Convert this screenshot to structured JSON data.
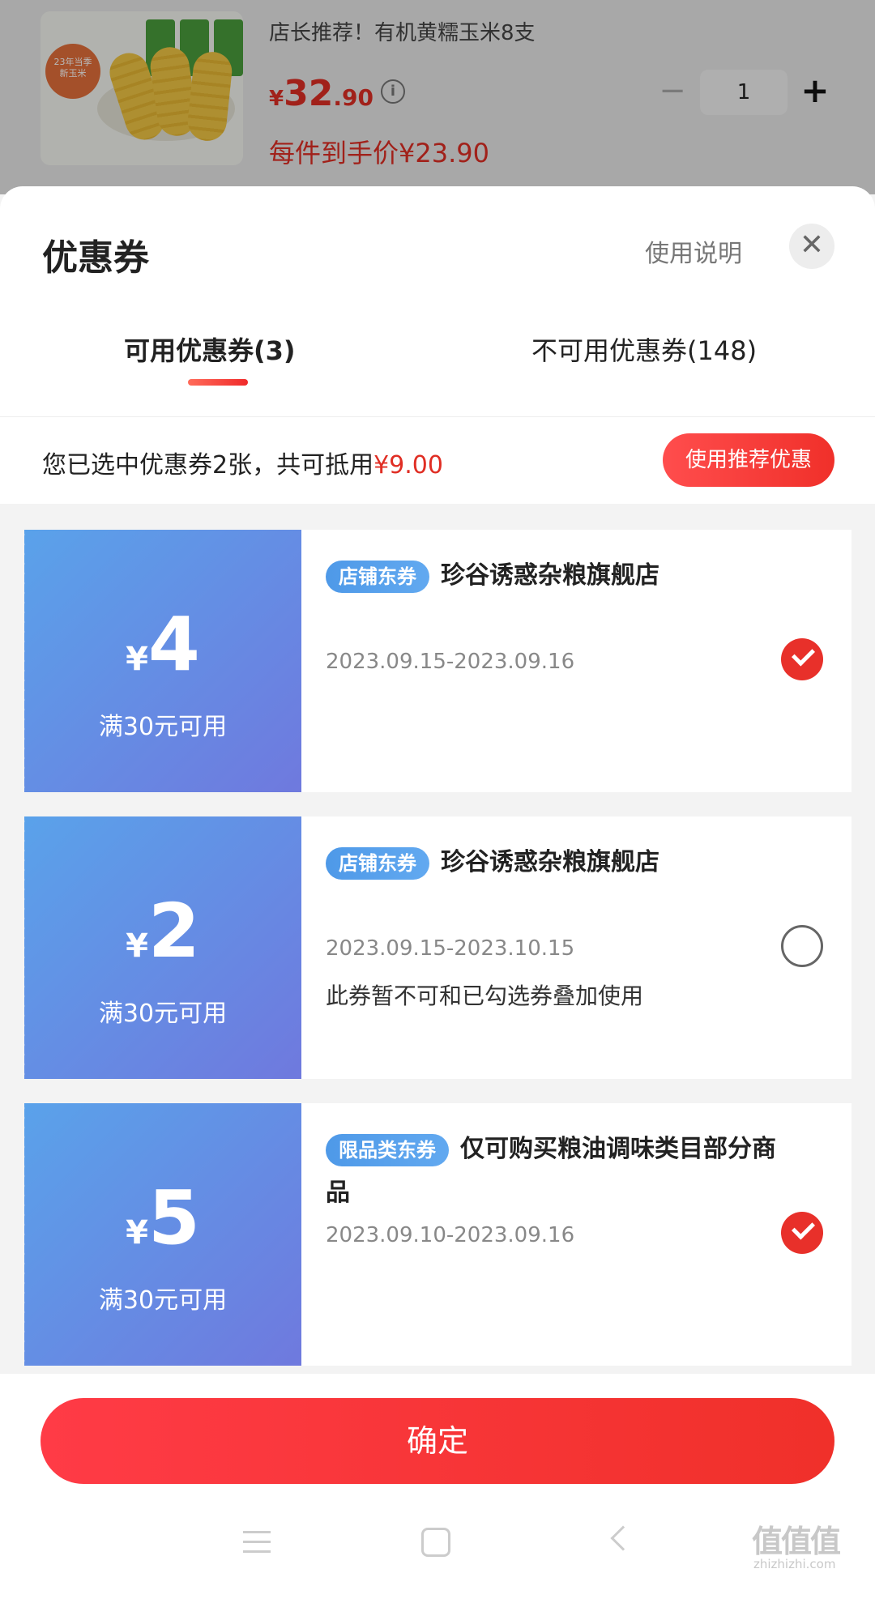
{
  "product": {
    "badge_line1": "23年当季",
    "badge_line2": "新玉米",
    "title": "店长推荐！有机黄糯玉米8支",
    "price_currency": "¥",
    "price_int": "32",
    "price_dec": ".90",
    "final_price": "每件到手价¥23.90",
    "quantity": "1",
    "minus": "−",
    "plus": "+"
  },
  "sheet": {
    "title": "优惠券",
    "help": "使用说明",
    "close": "✕"
  },
  "tabs": [
    {
      "label": "可用优惠券(3)",
      "active": true
    },
    {
      "label": "不可用优惠券(148)",
      "active": false
    }
  ],
  "summary": {
    "prefix": "您已选中优惠券2张，共可抵用",
    "amount": "¥9.00",
    "recommend_button": "使用推荐优惠"
  },
  "coupons": [
    {
      "yen": "¥",
      "amount": "4",
      "threshold": "满30元可用",
      "tag": "店铺东券",
      "title": "珍谷诱惑杂粮旗舰店",
      "date": "2023.09.15-2023.09.16",
      "note": "",
      "checked": true
    },
    {
      "yen": "¥",
      "amount": "2",
      "threshold": "满30元可用",
      "tag": "店铺东券",
      "title": "珍谷诱惑杂粮旗舰店",
      "date": "2023.09.15-2023.10.15",
      "note": "此券暂不可和已勾选券叠加使用",
      "checked": false
    },
    {
      "yen": "¥",
      "amount": "5",
      "threshold": "满30元可用",
      "tag": "限品类东券",
      "title": "仅可购买粮油调味类目部分商品",
      "date": "2023.09.10-2023.09.16",
      "note": "",
      "checked": true
    }
  ],
  "footer": {
    "confirm": "确定",
    "watermark": "值值值",
    "watermark_sub": "zhizhizhi.com"
  },
  "colors": {
    "accent": "#e02e24",
    "coupon_gradient_start": "#5aa2ea",
    "coupon_gradient_end": "#6f79de"
  }
}
